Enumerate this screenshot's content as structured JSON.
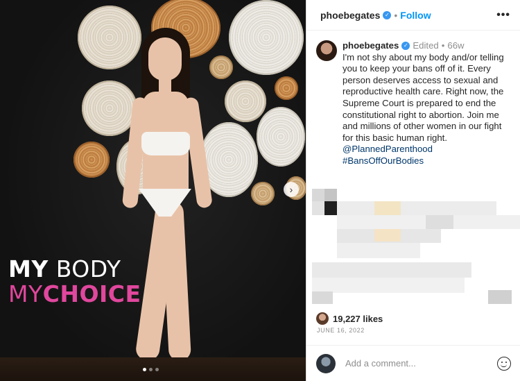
{
  "post": {
    "username": "phoebegates",
    "follow_label": "Follow",
    "more_label": "•••",
    "edited_label": "Edited",
    "age": "66w",
    "caption_lines": [
      "I'm not shy about my body and/or telling",
      "you to keep your bans off of it. Every",
      "person deserves access to sexual and",
      "reproductive health care. Right now, the",
      "Supreme Court is prepared to end the",
      "constitutional right to abortion. Join me",
      "and millions of other women in our fight",
      "for this basic human right."
    ],
    "mentions": [
      "@PlannedParenthood",
      "#BansOffOurBodies"
    ],
    "likes": "19,227 likes",
    "date": "JUNE 16, 2022",
    "comment_placeholder": "Add a comment..."
  },
  "media": {
    "slogan_line1_bold": "MY",
    "slogan_line1_thin": "BODY",
    "slogan_line2_thin": "MY",
    "slogan_line2_bold": "CHOICE",
    "slide_count": 3,
    "active_slide": 1,
    "accent_color": "#e0479d"
  }
}
